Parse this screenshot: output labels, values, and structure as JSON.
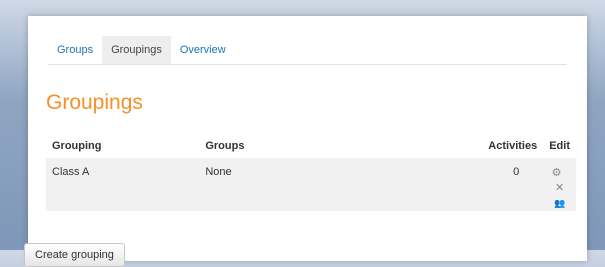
{
  "tabs": [
    {
      "label": "Groups"
    },
    {
      "label": "Groupings"
    },
    {
      "label": "Overview"
    }
  ],
  "page_title": "Groupings",
  "table": {
    "headers": {
      "grouping": "Grouping",
      "groups": "Groups",
      "activities": "Activities",
      "edit": "Edit"
    },
    "rows": [
      {
        "grouping": "Class A",
        "groups": "None",
        "activities": "0"
      }
    ]
  },
  "icons": {
    "settings": "⚙",
    "delete": "✕",
    "assign": "👥"
  },
  "create_button": "Create grouping",
  "colors": {
    "accent": "#f7902a",
    "link": "#1a75bb"
  }
}
